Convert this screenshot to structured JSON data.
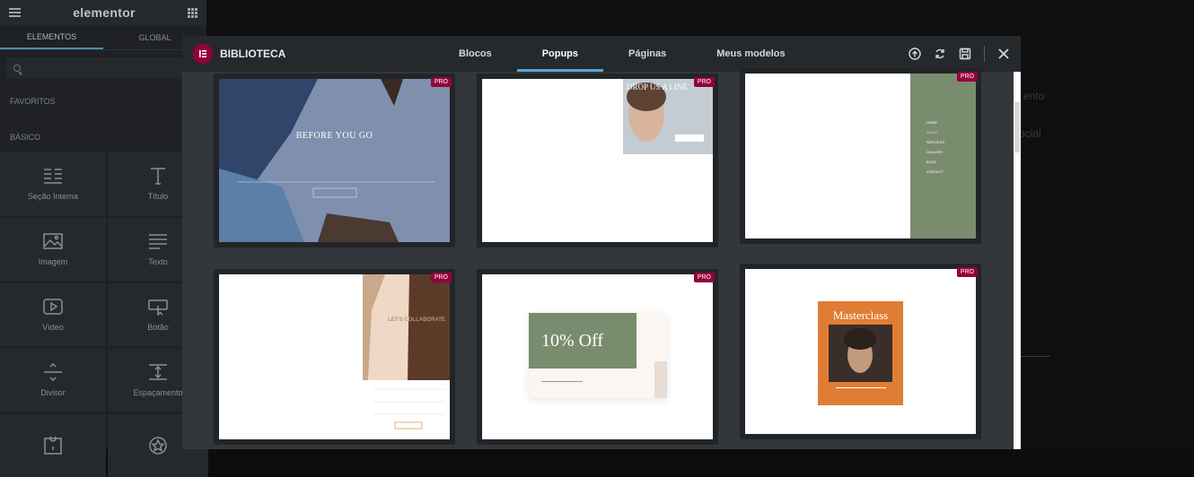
{
  "sidebar": {
    "logo": "elementor",
    "tabs": [
      "ELEMENTOS",
      "GLOBAL"
    ],
    "sections": {
      "favorites": "FAVORITOS",
      "basic": "BÁSICO"
    },
    "widgets": [
      {
        "label": "Seção Interna",
        "icon": "inner-section-icon"
      },
      {
        "label": "Título",
        "icon": "heading-icon"
      },
      {
        "label": "Imagem",
        "icon": "image-icon"
      },
      {
        "label": "Texto",
        "icon": "text-editor-icon"
      },
      {
        "label": "Vídeo",
        "icon": "video-icon"
      },
      {
        "label": "Botão",
        "icon": "button-icon"
      },
      {
        "label": "Divisor",
        "icon": "divider-icon"
      },
      {
        "label": "Espaçamento",
        "icon": "spacer-icon"
      },
      {
        "label": "",
        "icon": "google-maps-icon"
      },
      {
        "label": "",
        "icon": "icon-widget-icon"
      }
    ]
  },
  "editor": {
    "ghost_texts": [
      "ento",
      "ocial"
    ]
  },
  "modal": {
    "title": "BIBLIOTECA",
    "tabs": [
      {
        "label": "Blocos",
        "active": false
      },
      {
        "label": "Popups",
        "active": true
      },
      {
        "label": "Páginas",
        "active": false
      },
      {
        "label": "Meus modelos",
        "active": false
      }
    ],
    "tools": [
      "upload-icon",
      "sync-icon",
      "save-icon",
      "close-icon"
    ],
    "pro_badge": "PRO",
    "templates": [
      {
        "title": "BEFORE YOU GO",
        "accent": "#7d8ba8"
      },
      {
        "title": "DROP US A LINE",
        "accent": "#c9d1d6"
      },
      {
        "title": "",
        "accent": "#7a8c6e",
        "menu": [
          "HOME",
          "ABOUT",
          "SERVICES",
          "GALLERY",
          "BLOG",
          "CONTACT"
        ]
      },
      {
        "title": "LET'S COLLABORATE",
        "accent": "#b09a6a"
      },
      {
        "title": "10% Off",
        "accent": "#7a8c6e"
      },
      {
        "title": "Masterclass",
        "accent": "#e07d34"
      }
    ],
    "colors": {
      "brand": "#93003c",
      "active_tab": "#58a8d6"
    }
  }
}
